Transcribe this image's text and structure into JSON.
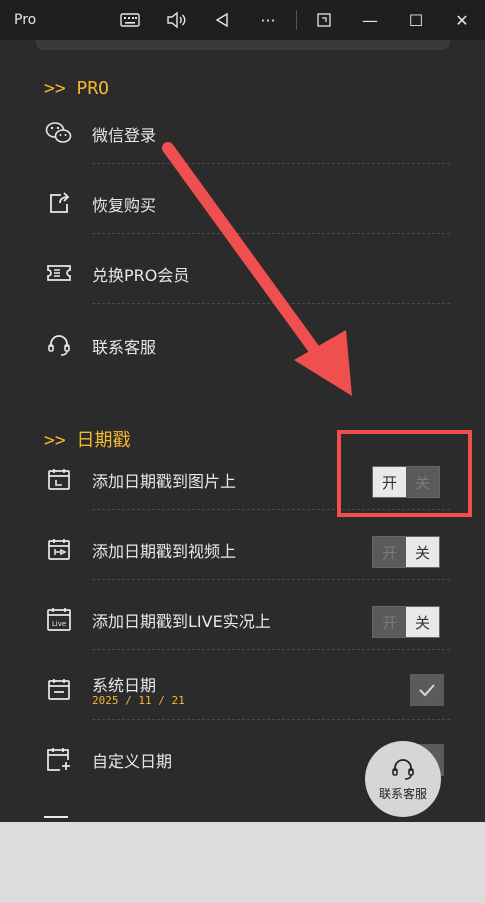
{
  "window": {
    "title": "Pro",
    "controls": {
      "keyboard": "keyboard-icon",
      "volume": "volume-icon",
      "back": "back-triangle-icon",
      "more": "···",
      "snap": "snap-icon",
      "minimize": "—",
      "maximize": "☐",
      "close": "✕"
    }
  },
  "sections": {
    "pro": {
      "title": ">> PRO",
      "items": [
        {
          "label": "微信登录",
          "icon": "wechat-icon"
        },
        {
          "label": "恢复购买",
          "icon": "share-icon"
        },
        {
          "label": "兑换PRO会员",
          "icon": "ticket-icon"
        },
        {
          "label": "联系客服",
          "icon": "headset-icon"
        }
      ]
    },
    "date": {
      "title": ">> 日期戳",
      "items": [
        {
          "label": "添加日期戳到图片上",
          "icon": "calendar-image-icon",
          "toggle": {
            "on": "开",
            "off": "关",
            "state": "on"
          }
        },
        {
          "label": "添加日期戳到视频上",
          "icon": "calendar-video-icon",
          "toggle": {
            "on": "开",
            "off": "关",
            "state": "off"
          }
        },
        {
          "label": "添加日期戳到LIVE实况上",
          "icon": "calendar-live-icon",
          "icon_text": "Live",
          "toggle": {
            "on": "开",
            "off": "关",
            "state": "off"
          }
        },
        {
          "label": "系统日期",
          "sublabel": "2025 / 11 / 21",
          "icon": "calendar-icon",
          "checked": true
        },
        {
          "label": "自定义日期",
          "icon": "calendar-add-icon",
          "checked": false
        }
      ]
    }
  },
  "float_button": {
    "label": "联系客服",
    "icon": "headset-icon"
  },
  "colors": {
    "accent": "#f3b82e",
    "annotation": "#ef4f4f",
    "background": "#2b2b2b"
  }
}
